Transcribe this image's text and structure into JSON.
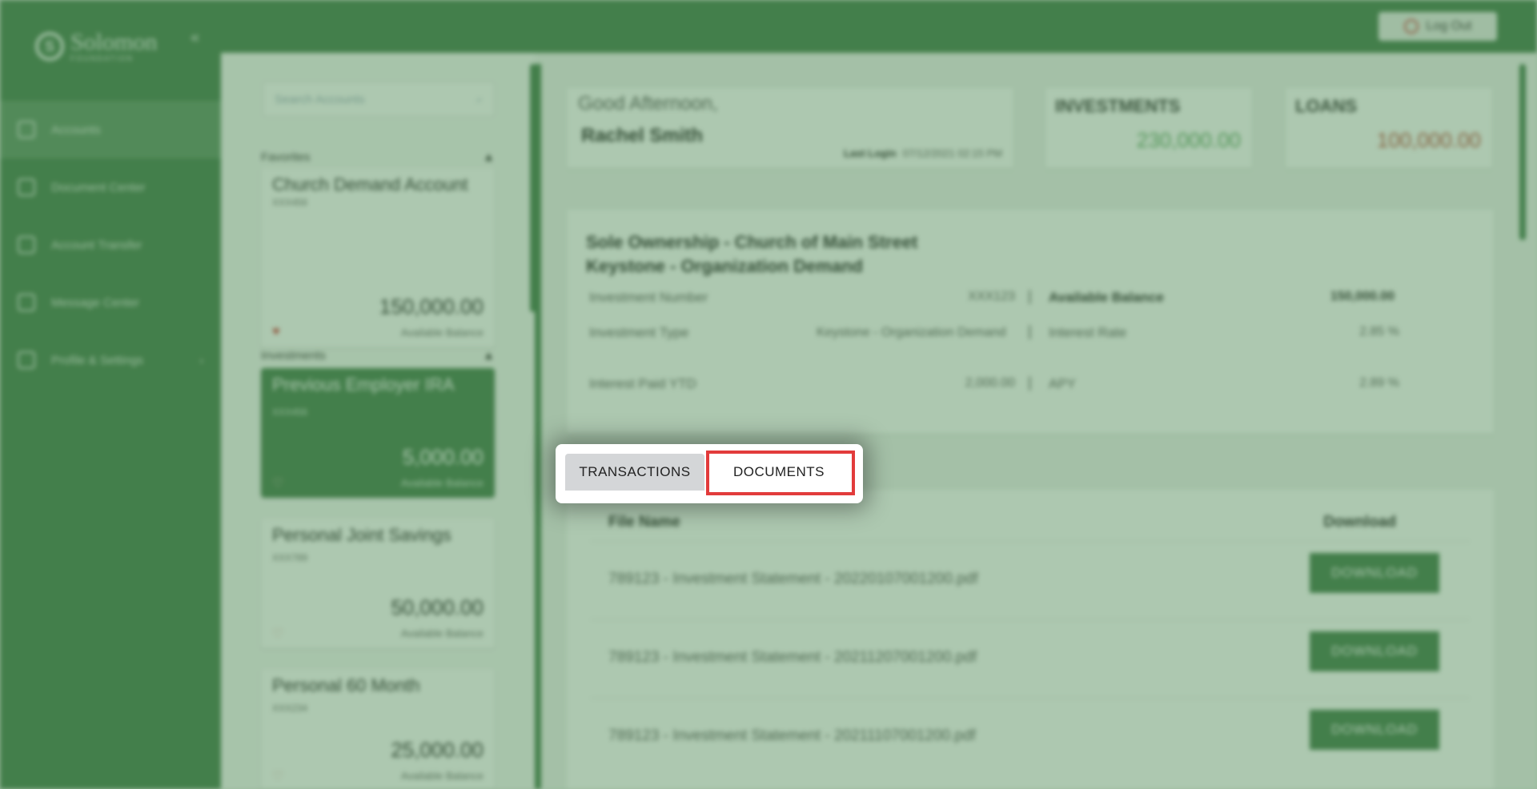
{
  "brand": {
    "name": "Solomon",
    "sub": "FOUNDATION"
  },
  "sidebar": {
    "items": [
      {
        "label": "Accounts",
        "active": true
      },
      {
        "label": "Document Center"
      },
      {
        "label": "Account Transfer"
      },
      {
        "label": "Message Center"
      },
      {
        "label": "Profile & Settings",
        "has_arrow": true
      }
    ]
  },
  "topbar": {
    "logout_label": "Log Out"
  },
  "accounts_panel": {
    "search_placeholder": "Search Accounts",
    "favorites_label": "Favorites",
    "investments_label": "Investments",
    "favorites": [
      {
        "title": "Church Demand Account",
        "number": "XXX456",
        "amount": "150,000.00",
        "balance_label": "Available Balance"
      }
    ],
    "investments": [
      {
        "title": "Previous Employer IRA",
        "number": "XXX456",
        "amount": "5,000.00",
        "balance_label": "Available Balance",
        "selected": true
      },
      {
        "title": "Personal Joint Savings",
        "number": "XXX789",
        "amount": "50,000.00",
        "balance_label": "Available Balance"
      },
      {
        "title": "Personal 60 Month",
        "number": "XXX234",
        "amount": "25,000.00",
        "balance_label": "Available Balance"
      }
    ]
  },
  "greeting": {
    "salutation": "Good Afternoon,",
    "user": "Rachel Smith",
    "last_login_label": "Last Login",
    "last_login_value": "07/12/2021 02:15 PM"
  },
  "totals": {
    "investments": {
      "label": "INVESTMENTS",
      "value": "230,000.00",
      "color": "#5aa45f"
    },
    "loans": {
      "label": "LOANS",
      "value": "100,000.00",
      "color": "#b84a3a"
    }
  },
  "account_detail": {
    "title_line1": "Sole Ownership - Church of Main Street",
    "title_line2": "Keystone - Organization Demand",
    "investment_number_label": "Investment Number",
    "investment_number": "XXX123",
    "available_balance_label": "Available Balance",
    "available_balance": "150,000.00",
    "investment_type_label": "Investment Type",
    "investment_type": "Keystone - Organization Demand",
    "interest_rate_label": "Interest Rate",
    "interest_rate": "2.85 %",
    "interest_paid_label": "Interest Paid YTD",
    "interest_paid": "2,000.00",
    "apy_label": "APY",
    "apy": "2.89 %"
  },
  "tabs": {
    "transactions": "TRANSACTIONS",
    "documents": "DOCUMENTS"
  },
  "documents": {
    "col_file": "File Name",
    "col_download": "Download",
    "download_label": "DOWNLOAD",
    "rows": [
      {
        "file": "789123 - Investment Statement - 20220107001200.pdf"
      },
      {
        "file": "789123 - Investment Statement - 20211207001200.pdf"
      },
      {
        "file": "789123 - Investment Statement - 20211107001200.pdf"
      }
    ]
  },
  "colors": {
    "brand_green": "#3f7a47",
    "highlight_red": "#e23b3b"
  }
}
